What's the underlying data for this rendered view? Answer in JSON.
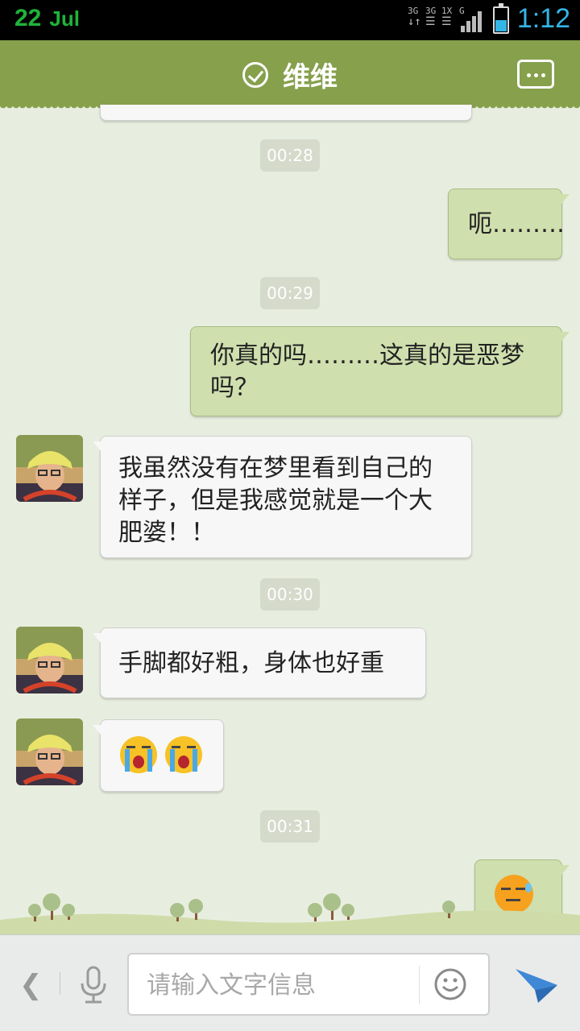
{
  "status_bar": {
    "day": "22",
    "month": "Jul",
    "network_a": "3G",
    "network_b": "3G",
    "network_c": "1X",
    "network_d": "G",
    "time": "1:12",
    "battery_level": 0.45
  },
  "header": {
    "title": "维维",
    "verified_icon": "check-circle-icon",
    "more_icon": "more-dots-icon"
  },
  "messages": [
    {
      "type": "timestamp",
      "text": "00:28"
    },
    {
      "type": "out",
      "text": "呃………"
    },
    {
      "type": "timestamp",
      "text": "00:29"
    },
    {
      "type": "out",
      "text": "你真的吗………这真的是恶梦吗？"
    },
    {
      "type": "in",
      "text": "我虽然没有在梦里看到自己的样子，但是我感觉就是一个大肥婆！！"
    },
    {
      "type": "timestamp",
      "text": "00:30"
    },
    {
      "type": "in",
      "text": "手脚都好粗，身体也好重"
    },
    {
      "type": "in",
      "emoji": [
        "crying-face",
        "crying-face"
      ]
    },
    {
      "type": "timestamp",
      "text": "00:31"
    },
    {
      "type": "out",
      "emoji": [
        "tired-sweat-face"
      ]
    }
  ],
  "input_bar": {
    "back_icon": "chevron-left-icon",
    "voice_icon": "microphone-icon",
    "placeholder": "请输入文字信息",
    "emoji_icon": "smiley-icon",
    "send_icon": "send-plane-icon"
  },
  "colors": {
    "header": "#86a04c",
    "background": "#e8eedf",
    "outgoing_bubble": "#cfdfae",
    "incoming_bubble": "#f7f7f7",
    "timestamp": "#d5dacb",
    "status_time": "#33b5e5",
    "status_date": "#1fb33a"
  }
}
